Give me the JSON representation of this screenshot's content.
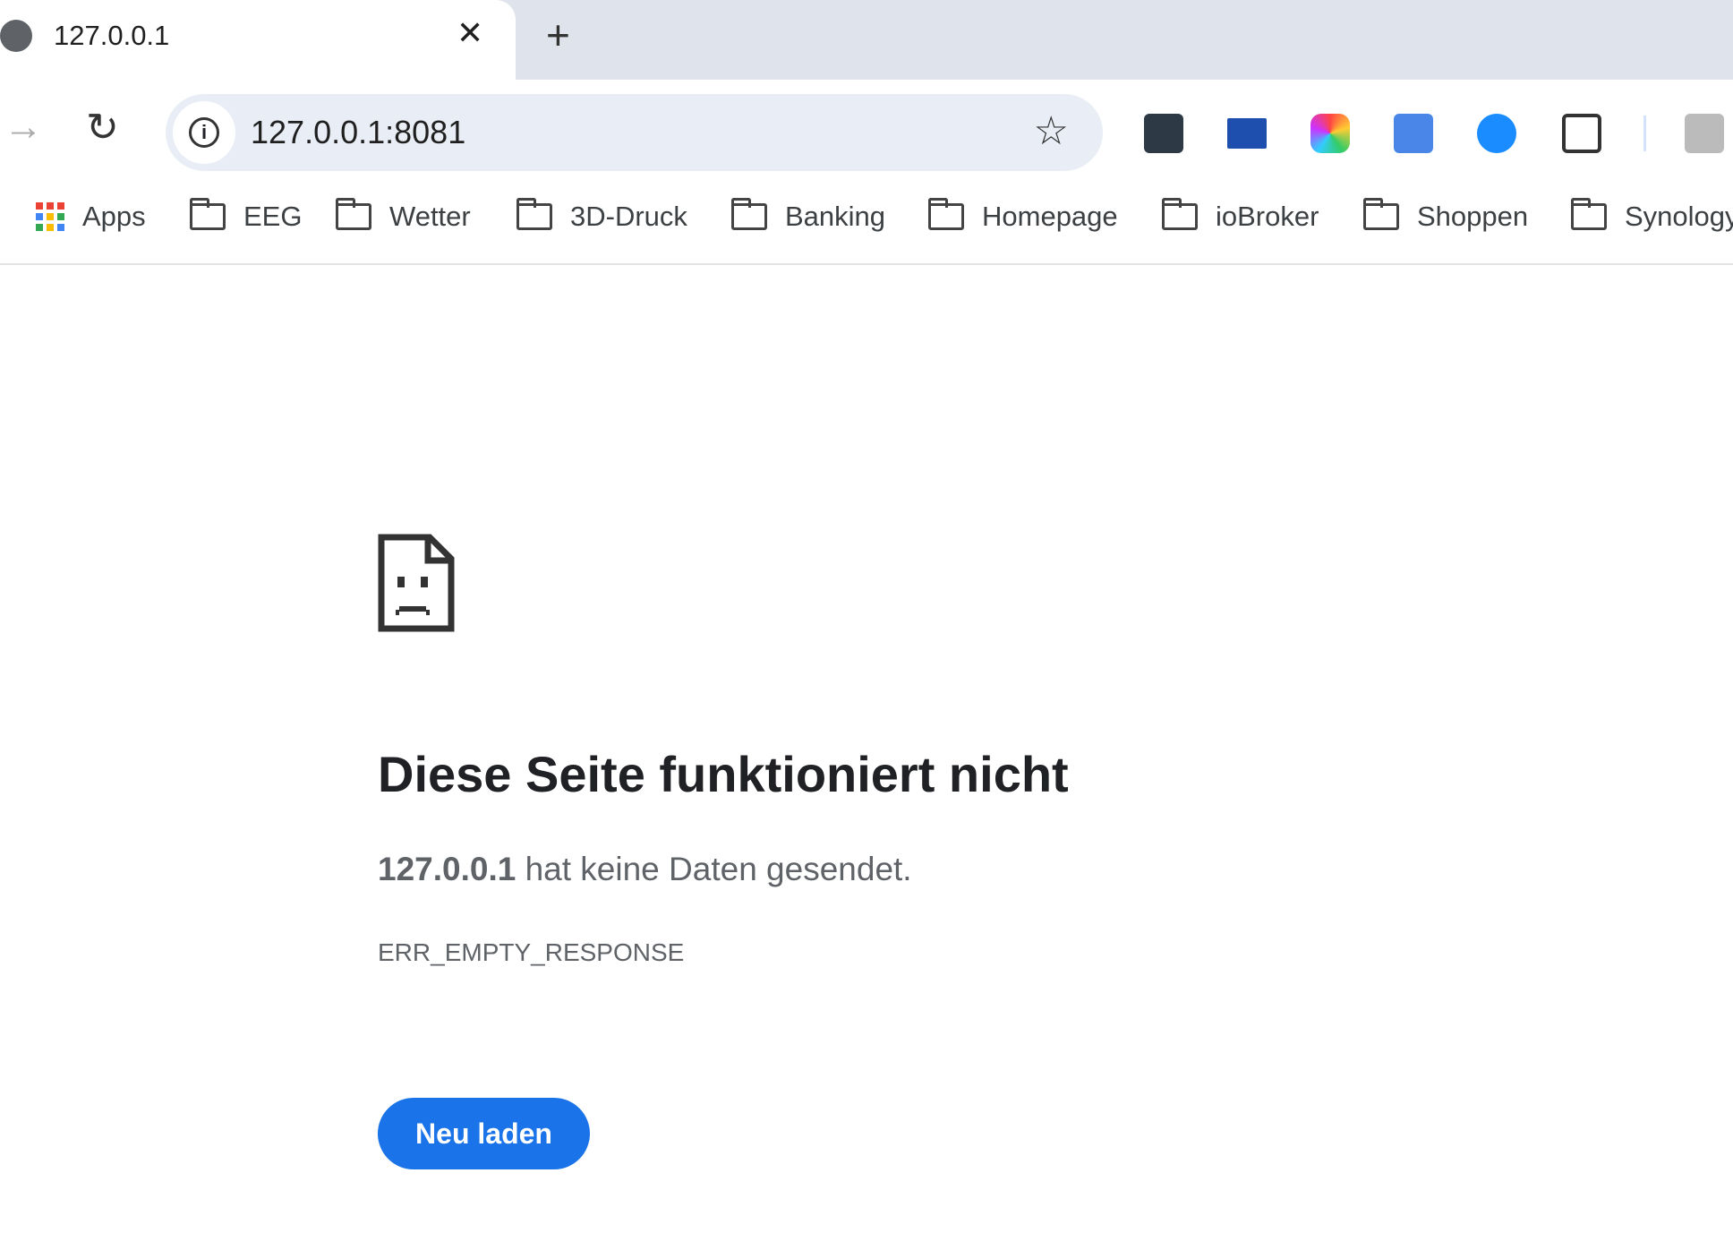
{
  "tab": {
    "title": "127.0.0.1",
    "close_icon": "close-icon",
    "new_tab": "+"
  },
  "toolbar": {
    "url": "127.0.0.1:8081",
    "extensions": [
      "password-manager-icon",
      "mail-icon",
      "color-picker-icon",
      "google-translate-icon",
      "shazam-icon",
      "extensions-puzzle-icon",
      "translate-icon"
    ]
  },
  "bookmarks": [
    {
      "label": "Apps",
      "icon": "apps-grid-icon"
    },
    {
      "label": "EEG"
    },
    {
      "label": "Wetter"
    },
    {
      "label": "3D-Druck"
    },
    {
      "label": "Banking"
    },
    {
      "label": "Homepage"
    },
    {
      "label": "ioBroker"
    },
    {
      "label": "Shoppen"
    },
    {
      "label": "Synology"
    }
  ],
  "error": {
    "title": "Diese Seite funktioniert nicht",
    "host": "127.0.0.1",
    "message": " hat keine Daten gesendet.",
    "code": "ERR_EMPTY_RESPONSE",
    "reload_label": "Neu laden"
  },
  "colors": {
    "accent": "#1a73e8",
    "tabstrip": "#dfe3eb",
    "omnibox": "#e9eef6"
  }
}
